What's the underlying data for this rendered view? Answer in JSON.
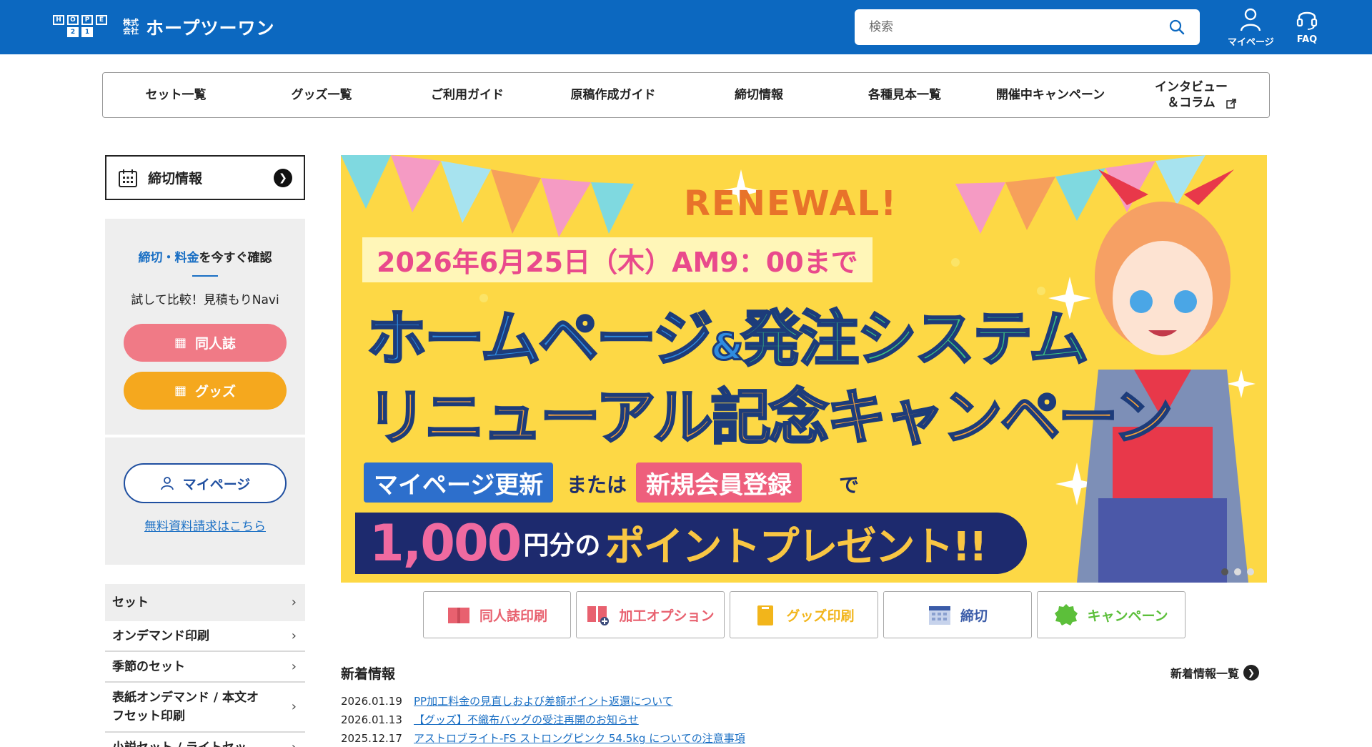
{
  "header": {
    "logo_box_top": [
      "H",
      "O",
      "P",
      "E"
    ],
    "logo_box_bottom": [
      "2",
      "1"
    ],
    "logo_small": "株式会社",
    "logo_name": "ホープツーワン",
    "search_placeholder": "検索",
    "mypage_label": "マイページ",
    "faq_label": "FAQ"
  },
  "nav": {
    "items": [
      "セット一覧",
      "グッズ一覧",
      "ご利用ガイド",
      "原稿作成ガイド",
      "締切情報",
      "各種見本一覧",
      "開催中キャンペーン",
      "インタビュー\n＆コラム"
    ]
  },
  "sidebar": {
    "deadline_label": "締切情報",
    "estimate": {
      "title_blue": "締切・料金",
      "title_rest": "を今すぐ確認",
      "subtitle": "試して比較！見積もりNavi",
      "btn_doujin": "同人誌",
      "btn_goods": "グッズ"
    },
    "mypage_btn": "マイページ",
    "request_link": "無料資料請求はこちら",
    "menu_head": "セット",
    "menu_items": [
      "オンデマンド印刷",
      "季節のセット",
      "表紙オンデマンド / 本文オ\nフセット印刷",
      "小説セット / ライトセッ"
    ]
  },
  "banner": {
    "renewal": "RENEWAL!",
    "date": "2026年6月25日（木）AM9：00まで",
    "line1_a": "ホームページ",
    "line1_amp": "&",
    "line1_b": "発注システム",
    "line2": "リニューアル記念キャンペーン",
    "tag1": "マイページ更新",
    "mid1": "または",
    "tag2": "新規会員登録",
    "mid2": "で",
    "amount": "1,000",
    "yen": "円分の",
    "present": "ポイントプレゼント!!"
  },
  "quick_links": [
    {
      "label": "同人誌印刷",
      "color": "#e8616f"
    },
    {
      "label": "加工オプション",
      "color": "#e8616f"
    },
    {
      "label": "グッズ印刷",
      "color": "#f2b51b"
    },
    {
      "label": "締切",
      "color": "#3a5ba8"
    },
    {
      "label": "キャンペーン",
      "color": "#5cbf3a"
    }
  ],
  "news": {
    "title": "新着情報",
    "all_link": "新着情報一覧",
    "items": [
      {
        "date": "2026.01.19",
        "text": "PP加工料金の見直しおよび差額ポイント返還について"
      },
      {
        "date": "2026.01.13",
        "text": "【グッズ】不織布バッグの受注再開のお知らせ"
      },
      {
        "date": "2025.12.17",
        "text": "アストロブライト-FS ストロングピンク 54.5kg についての注意事項"
      }
    ]
  },
  "colors": {
    "header_bg": "#0c68c0",
    "accent_blue": "#1a6fc4",
    "pink": "#f07a86",
    "orange": "#f5a81e",
    "banner_bg": "#fdd845"
  }
}
